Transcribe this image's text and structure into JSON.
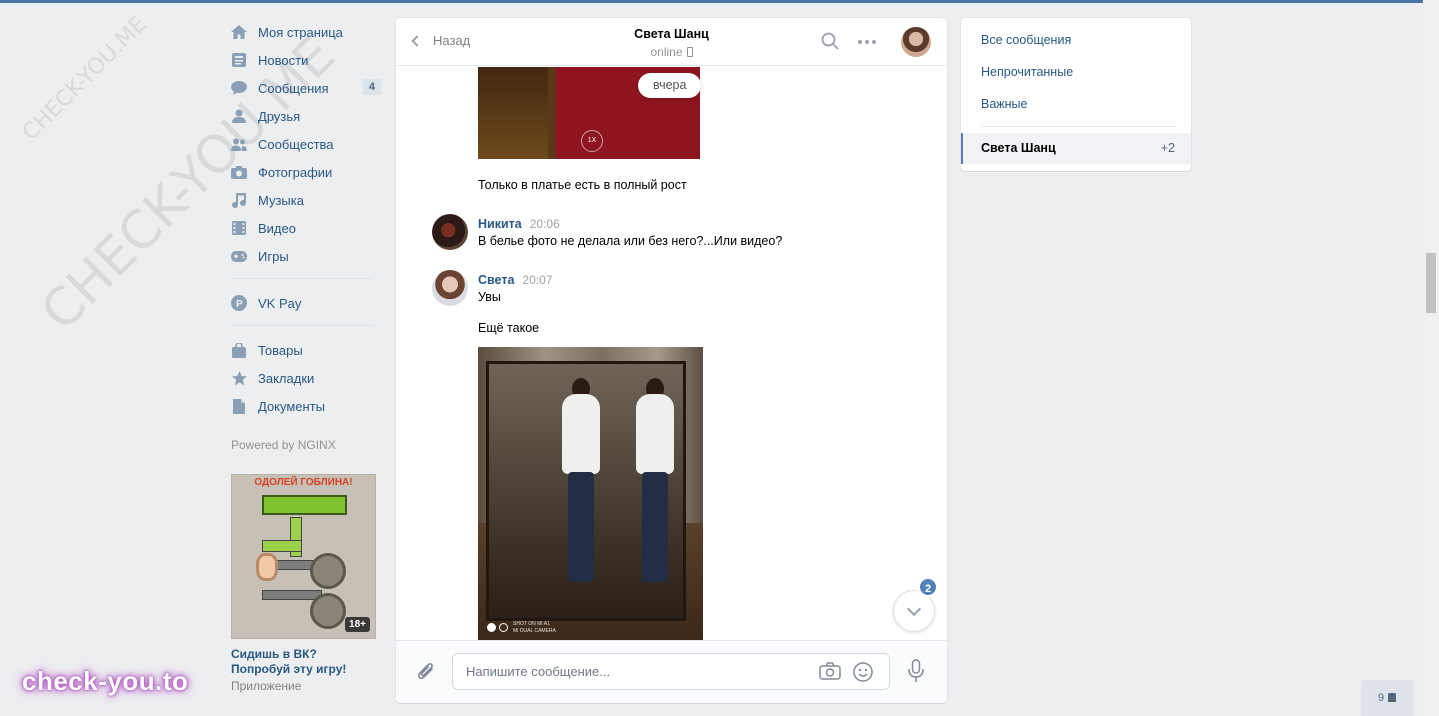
{
  "watermark": {
    "small": "CHECK-YOU.ME",
    "large": "CHECK-YOU.ME",
    "bottom": "check-you.to"
  },
  "leftnav": {
    "items": [
      {
        "label": "Моя страница",
        "icon": "home-icon"
      },
      {
        "label": "Новости",
        "icon": "news-icon"
      },
      {
        "label": "Сообщения",
        "icon": "messages-icon",
        "count": "4"
      },
      {
        "label": "Друзья",
        "icon": "friends-icon"
      },
      {
        "label": "Сообщества",
        "icon": "groups-icon"
      },
      {
        "label": "Фотографии",
        "icon": "camera-icon"
      },
      {
        "label": "Музыка",
        "icon": "music-icon"
      },
      {
        "label": "Видео",
        "icon": "video-icon"
      },
      {
        "label": "Игры",
        "icon": "games-icon"
      }
    ],
    "vkpay": {
      "label": "VK Pay",
      "icon": "vkpay-icon"
    },
    "extra": [
      {
        "label": "Товары",
        "icon": "bag-icon"
      },
      {
        "label": "Закладки",
        "icon": "star-icon"
      },
      {
        "label": "Документы",
        "icon": "document-icon"
      }
    ],
    "powered": "Powered by NGINX",
    "ad": {
      "image_title": "ОДОЛЕЙ ГОБЛИНА!",
      "age": "18+",
      "title": "Сидишь в ВК? Попробуй эту игру!",
      "subtitle": "Приложение"
    }
  },
  "chat": {
    "back_label": "Назад",
    "title": "Света Шанц",
    "status": "online",
    "date_pill": "вчера",
    "speed_label": "1X",
    "messages": [
      {
        "text": "Только в платье есть в полный рост"
      },
      {
        "author": "Никита",
        "time": "20:06",
        "text": "В белье фото не делала или без него?...Или видео?"
      },
      {
        "author": "Света",
        "time": "20:07",
        "text": "Увы",
        "text2": "Ещё такое"
      }
    ],
    "photo_watermark": "SHOT ON MI A1\nMI DUAL CAMERA",
    "unread_badge": "2",
    "composer_placeholder": "Напишите сообщение..."
  },
  "rpanel": {
    "items": [
      "Все сообщения",
      "Непрочитанные",
      "Важные"
    ],
    "active": {
      "name": "Света Шанц",
      "count": "+2"
    }
  },
  "footer": {
    "online_count": "9"
  },
  "colors": {
    "accent": "#4a76a8",
    "link": "#2a5885",
    "page_bg": "#edeef0"
  }
}
